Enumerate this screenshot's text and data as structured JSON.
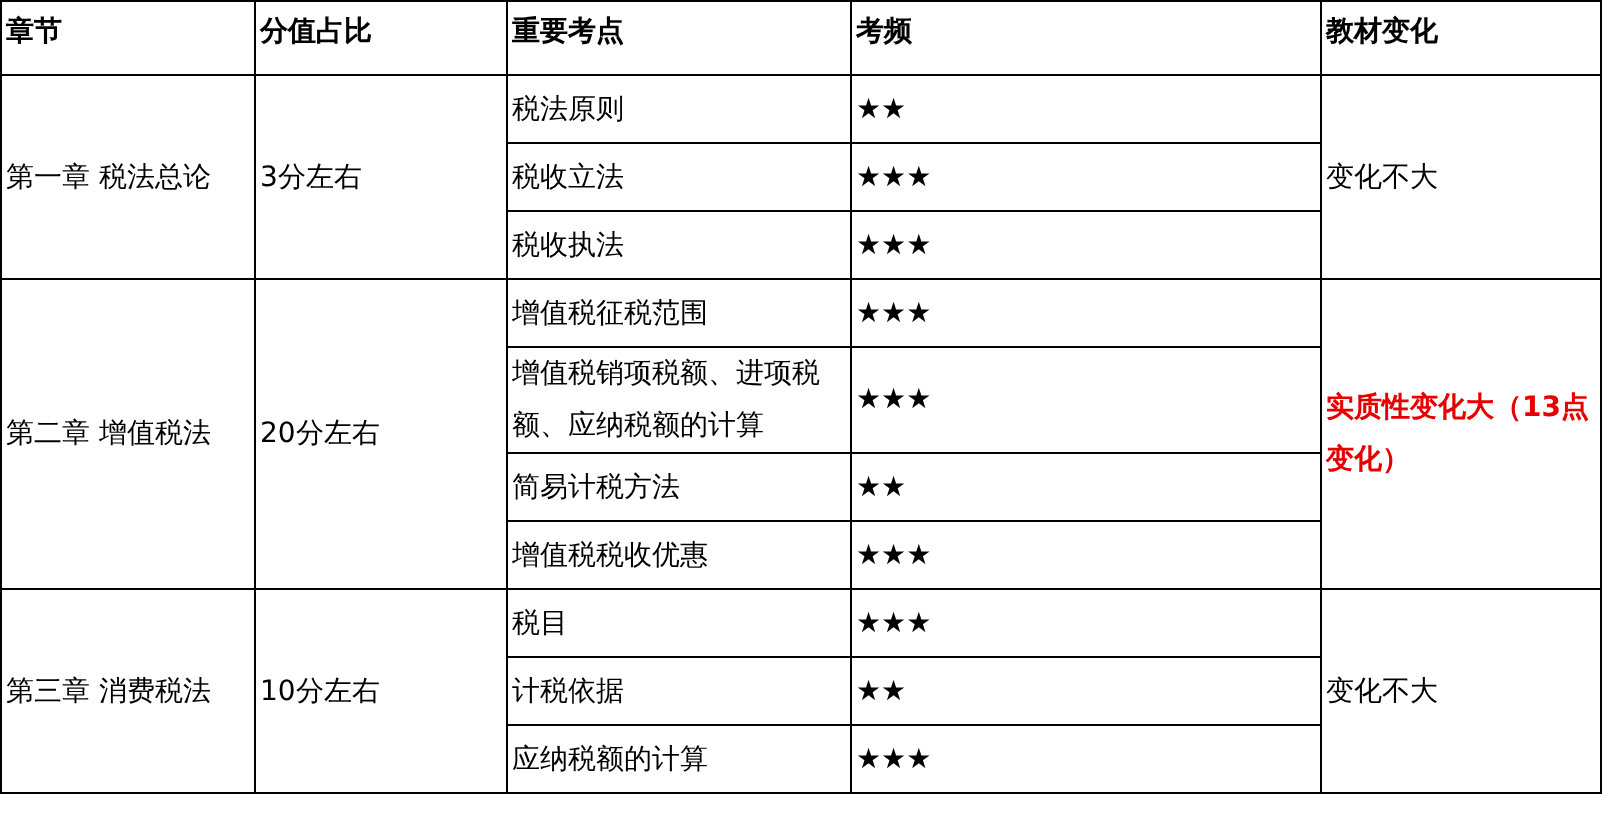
{
  "columns": [
    "章节",
    "分值占比",
    "重要考点",
    "考频",
    "教材变化"
  ],
  "chapters": [
    {
      "chapter": "第一章 税法总论",
      "score": "3分左右",
      "change": "变化不大",
      "emphasis": false,
      "points": [
        {
          "name": "税法原则",
          "frequency": "★★"
        },
        {
          "name": "税收立法",
          "frequency": "★★★"
        },
        {
          "name": "税收执法",
          "frequency": "★★★"
        }
      ]
    },
    {
      "chapter": "第二章 增值税法",
      "score": "20分左右",
      "change": "实质性变化大（13点变化）",
      "emphasis": true,
      "points": [
        {
          "name": "增值税征税范围",
          "frequency": "★★★"
        },
        {
          "name": "增值税销项税额、进项税额、应纳税额的计算",
          "frequency": "★★★"
        },
        {
          "name": "简易计税方法",
          "frequency": "★★"
        },
        {
          "name": "增值税税收优惠",
          "frequency": "★★★"
        }
      ]
    },
    {
      "chapter": "第三章 消费税法",
      "score": "10分左右",
      "change": "变化不大",
      "emphasis": false,
      "points": [
        {
          "name": "税目",
          "frequency": "★★★"
        },
        {
          "name": "计税依据",
          "frequency": "★★"
        },
        {
          "name": "应纳税额的计算",
          "frequency": "★★★"
        }
      ]
    }
  ]
}
